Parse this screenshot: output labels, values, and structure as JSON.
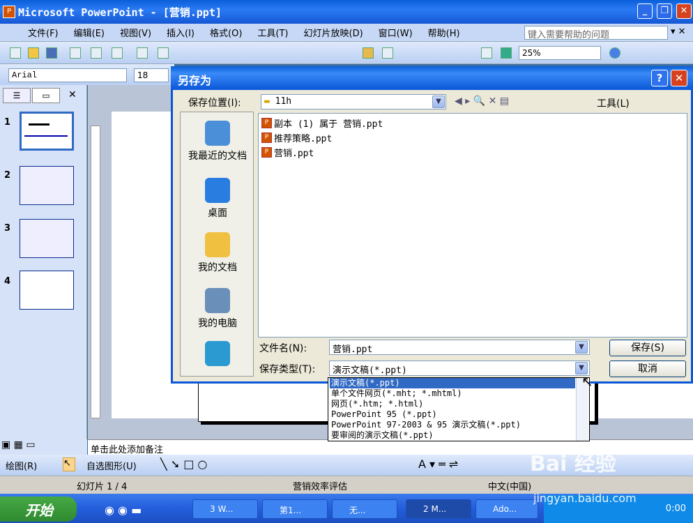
{
  "app": {
    "title": "Microsoft PowerPoint - [营销.ppt]"
  },
  "menu": {
    "items": [
      "文件(F)",
      "编辑(E)",
      "视图(V)",
      "插入(I)",
      "格式(O)",
      "工具(T)",
      "幻灯片放映(D)",
      "窗口(W)",
      "帮助(H)"
    ],
    "help_placeholder": "键入需要帮助的问题"
  },
  "format": {
    "font": "Arial",
    "size": "18",
    "zoom": "25%"
  },
  "slides": {
    "numbers": [
      "1",
      "2",
      "3",
      "4"
    ]
  },
  "notes": {
    "placeholder": "单击此处添加备注"
  },
  "drawbar": {
    "draw_label": "绘图(R)",
    "autoshape_label": "自选图形(U)"
  },
  "status": {
    "slide": "幻灯片 1 / 4",
    "design": "营销效率评估",
    "lang": "中文(中国)"
  },
  "taskbar": {
    "start": "开始",
    "tasks": [
      "3 W...",
      "第1...",
      "无...",
      "2 M...",
      "Ado..."
    ],
    "time": "0:00"
  },
  "dialog": {
    "title": "另存为",
    "save_in_label": "保存位置(I):",
    "save_in_value": "11h",
    "tools_label": "工具(L)",
    "places": [
      "我最近的文档",
      "桌面",
      "我的文档",
      "我的电脑"
    ],
    "files": [
      "副本 (1) 属于 营销.ppt",
      "推荐策略.ppt",
      "营销.ppt"
    ],
    "filename_label": "文件名(N):",
    "filename_value": "营销.ppt",
    "filetype_label": "保存类型(T):",
    "filetype_value": "演示文稿(*.ppt)",
    "save_button": "保存(S)",
    "cancel_button": "取消",
    "filetype_options": [
      "演示文稿(*.ppt)",
      "单个文件网页(*.mht; *.mhtml)",
      "网页(*.htm; *.html)",
      "PowerPoint 95 (*.ppt)",
      "PowerPoint 97-2003 & 95 演示文稿(*.ppt)",
      "要审阅的演示文稿(*.ppt)"
    ]
  },
  "watermark": {
    "brand": "Bai 经验",
    "url": "jingyan.baidu.com"
  },
  "colors": {
    "titlebar": "#0a5fd8",
    "selection": "#316ac5",
    "close": "#d7421e"
  }
}
